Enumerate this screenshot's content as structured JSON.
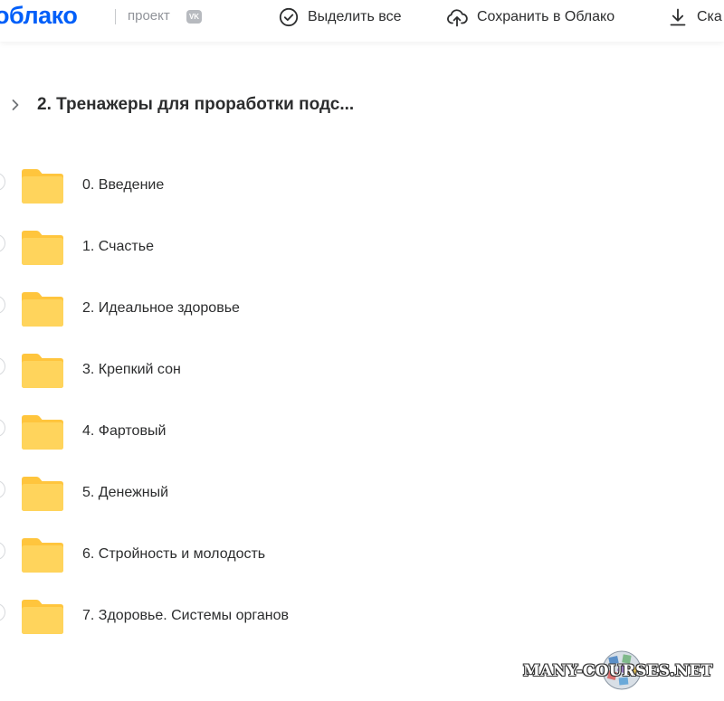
{
  "header": {
    "logo_text": "облако",
    "project_label": "проект",
    "vk_badge": "VK",
    "actions": {
      "select_all": "Выделить все",
      "save_to_cloud": "Сохранить в Облако",
      "download": "Ска"
    }
  },
  "breadcrumb": {
    "title": "2. Тренажеры для проработки подс..."
  },
  "folders": [
    {
      "name": "0. Введение"
    },
    {
      "name": "1. Счастье"
    },
    {
      "name": "2. Идеальное здоровье"
    },
    {
      "name": "3. Крепкий сон"
    },
    {
      "name": "4. Фартовый"
    },
    {
      "name": "5. Денежный"
    },
    {
      "name": "6. Стройность и молодость"
    },
    {
      "name": "7. Здоровье. Системы органов"
    }
  ],
  "watermark": {
    "text": "MANY-COURSES.NET"
  },
  "icons": {
    "select_all": "check-circle-icon",
    "save_to_cloud": "cloud-upload-icon",
    "download": "download-icon",
    "breadcrumb": "chevron-right-icon",
    "folder": "folder-icon"
  },
  "colors": {
    "brand": "#005ff9",
    "folder": "#ffd45c",
    "folder_back": "#ffc53d",
    "text": "#2c2d2e",
    "muted": "#909399"
  }
}
